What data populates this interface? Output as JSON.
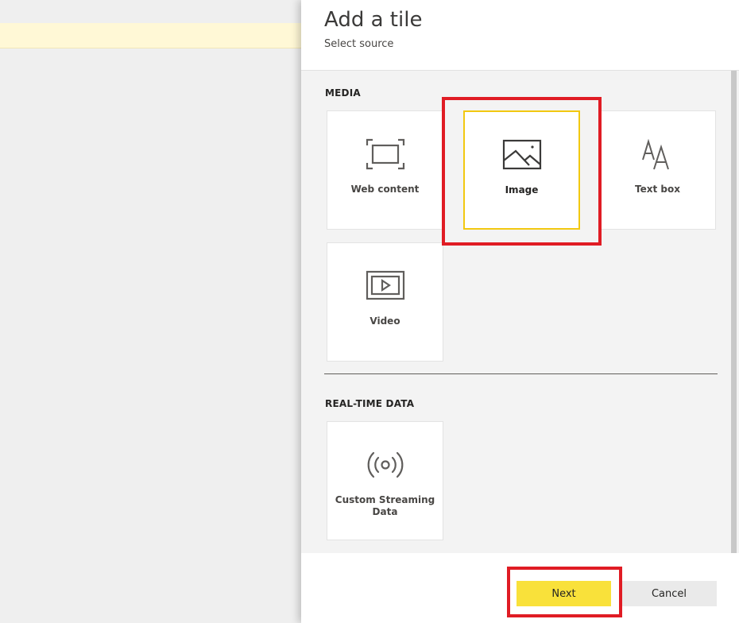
{
  "panel": {
    "title": "Add a tile",
    "subtitle": "Select source"
  },
  "media": {
    "heading": "MEDIA",
    "tiles": [
      {
        "label": "Web content",
        "icon": "web-content-icon"
      },
      {
        "label": "Image",
        "icon": "image-icon",
        "selected": true
      },
      {
        "label": "Text box",
        "icon": "text-box-icon"
      },
      {
        "label": "Video",
        "icon": "video-icon"
      }
    ]
  },
  "realtime": {
    "heading": "REAL-TIME DATA",
    "tiles": [
      {
        "label": "Custom Streaming Data",
        "icon": "streaming-icon"
      }
    ]
  },
  "footer": {
    "next_label": "Next",
    "cancel_label": "Cancel"
  },
  "colors": {
    "accent": "#f2c811",
    "next_button": "#f9e13a",
    "annotation": "#e01c24",
    "icon": "#605e5c"
  }
}
